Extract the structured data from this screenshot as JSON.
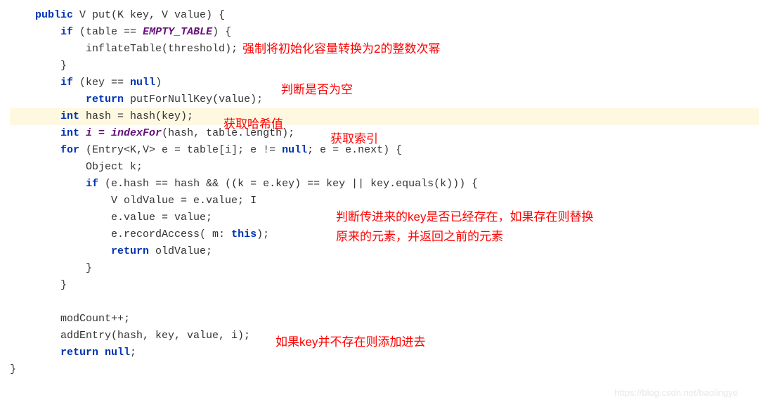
{
  "code": {
    "lines": [
      {
        "indent": 1,
        "segments": [
          [
            "kw",
            "public"
          ],
          [
            "plain",
            " V put(K key, V value) {"
          ]
        ]
      },
      {
        "indent": 2,
        "segments": [
          [
            "kw",
            "if"
          ],
          [
            "plain",
            " (table == "
          ],
          [
            "const",
            "EMPTY_TABLE"
          ],
          [
            "plain",
            ") {"
          ]
        ]
      },
      {
        "indent": 3,
        "segments": [
          [
            "plain",
            "inflateTable(threshold);"
          ]
        ]
      },
      {
        "indent": 2,
        "segments": [
          [
            "plain",
            "}"
          ]
        ]
      },
      {
        "indent": 2,
        "segments": [
          [
            "kw",
            "if"
          ],
          [
            "plain",
            " (key == "
          ],
          [
            "kw",
            "null"
          ],
          [
            "plain",
            ")"
          ]
        ]
      },
      {
        "indent": 3,
        "segments": [
          [
            "kw",
            "return"
          ],
          [
            "plain",
            " putForNullKey(value);"
          ]
        ]
      },
      {
        "indent": 2,
        "segments": [
          [
            "kw",
            "int"
          ],
          [
            "plain",
            " hash = hash(key);"
          ]
        ],
        "highlight": true
      },
      {
        "indent": 2,
        "segments": [
          [
            "kw",
            "int"
          ],
          [
            "const",
            " i = indexFor"
          ],
          [
            "plain",
            "(hash, table.length);"
          ]
        ]
      },
      {
        "indent": 2,
        "segments": [
          [
            "kw",
            "for"
          ],
          [
            "plain",
            " (Entry<K,V> e = table[i]; e != "
          ],
          [
            "kw",
            "null"
          ],
          [
            "plain",
            "; e = e.next) {"
          ]
        ]
      },
      {
        "indent": 3,
        "segments": [
          [
            "plain",
            "Object k;"
          ]
        ]
      },
      {
        "indent": 3,
        "segments": [
          [
            "kw",
            "if"
          ],
          [
            "plain",
            " (e.hash == hash && ((k = e.key) == key || key.equals(k))) {"
          ]
        ]
      },
      {
        "indent": 4,
        "segments": [
          [
            "plain",
            "V oldValue = e.value; "
          ],
          [
            "cursor",
            "I"
          ]
        ]
      },
      {
        "indent": 4,
        "segments": [
          [
            "plain",
            "e.value = value;"
          ]
        ]
      },
      {
        "indent": 4,
        "segments": [
          [
            "plain",
            "e.recordAccess( m: "
          ],
          [
            "kw",
            "this"
          ],
          [
            "plain",
            ");"
          ]
        ]
      },
      {
        "indent": 4,
        "segments": [
          [
            "kw",
            "return"
          ],
          [
            "plain",
            " oldValue;"
          ]
        ]
      },
      {
        "indent": 3,
        "segments": [
          [
            "plain",
            "}"
          ]
        ]
      },
      {
        "indent": 2,
        "segments": [
          [
            "plain",
            "}"
          ]
        ]
      },
      {
        "indent": 0,
        "segments": [
          [
            "plain",
            " "
          ]
        ]
      },
      {
        "indent": 2,
        "segments": [
          [
            "plain",
            "modCount++;"
          ]
        ]
      },
      {
        "indent": 2,
        "segments": [
          [
            "plain",
            "addEntry(hash, key, value, i);"
          ]
        ]
      },
      {
        "indent": 2,
        "segments": [
          [
            "kw",
            "return null"
          ],
          [
            "plain",
            ";"
          ]
        ]
      },
      {
        "indent": 0,
        "segments": [
          [
            "plain",
            "}"
          ]
        ]
      }
    ]
  },
  "annotations": {
    "a1": "强制将初始化容量转换为2的整数次幂",
    "a2": "判断是否为空",
    "a3": "获取哈希值",
    "a4": "获取索引",
    "a5": "判断传进来的key是否已经存在，如果存在则替换",
    "a6": "原来的元素，并返回之前的元素",
    "a7": "如果key并不存在则添加进去"
  },
  "watermark": "https://blog.csdn.net/baolingye"
}
